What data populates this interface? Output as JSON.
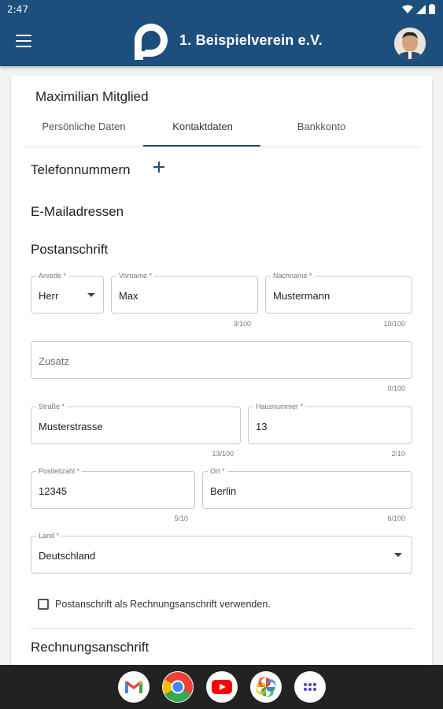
{
  "status_bar": {
    "time": "2:47"
  },
  "app_bar": {
    "title": "1. Beispielverein e.V."
  },
  "member": {
    "name": "Maximilian Mitglied"
  },
  "tabs": [
    {
      "label": "Persönliche Daten"
    },
    {
      "label": "Kontaktdaten"
    },
    {
      "label": "Bankkonto"
    }
  ],
  "active_tab": "Kontaktdaten",
  "sections": {
    "phone": "Telefonnummern",
    "email": "E-Mailadressen",
    "postal": "Postanschrift",
    "billing": "Rechnungsanschrift"
  },
  "form": {
    "salutation": {
      "label": "Anrede *",
      "value": "Herr"
    },
    "first_name": {
      "label": "Vorname *",
      "value": "Max",
      "counter": "3/100"
    },
    "last_name": {
      "label": "Nachname *",
      "value": "Mustermann",
      "counter": "10/100"
    },
    "addition": {
      "placeholder": "Zusatz",
      "counter": "0/100"
    },
    "street": {
      "label": "Straße *",
      "value": "Musterstrasse",
      "counter": "13/100"
    },
    "house_number": {
      "label": "Hausnummer *",
      "value": "13",
      "counter": "2/10"
    },
    "postal_code": {
      "label": "Postleitzahl *",
      "value": "12345",
      "counter": "5/10"
    },
    "city": {
      "label": "Ort *",
      "value": "Berlin",
      "counter": "6/100"
    },
    "country": {
      "label": "Land *",
      "value": "Deutschland"
    },
    "use_as_billing": {
      "label": "Postanschrift als Rechnungsanschrift verwenden.",
      "checked": false
    }
  },
  "dock": [
    "gmail-icon",
    "chrome-icon",
    "youtube-icon",
    "photos-icon",
    "apps-icon"
  ],
  "colors": {
    "primary": "#1d4f7d",
    "navbar": "#222222"
  }
}
